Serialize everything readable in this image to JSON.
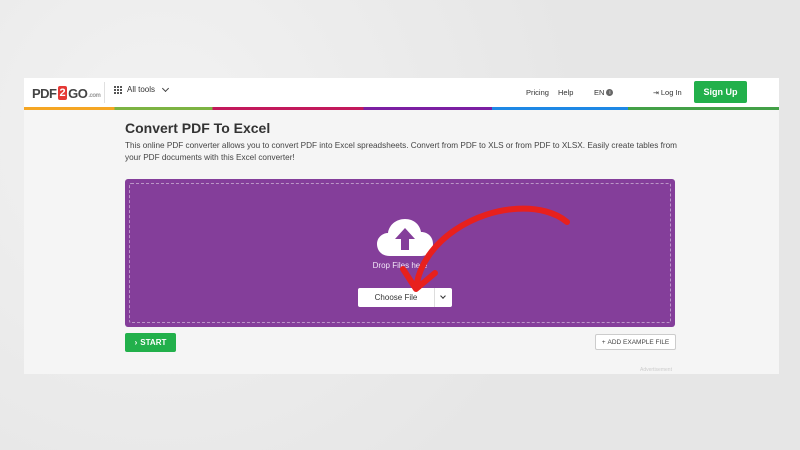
{
  "header": {
    "logo": {
      "pdf": "PDF",
      "two": "2",
      "go": "GO",
      "dotcom": ".com"
    },
    "all_tools": "All tools",
    "pricing": "Pricing",
    "help": "Help",
    "language": "EN",
    "login": "Log In",
    "signup": "Sign Up"
  },
  "main": {
    "title": "Convert PDF To Excel",
    "description": "This online PDF converter allows you to convert PDF into Excel spreadsheets. Convert from PDF to XLS or from PDF to XLSX. Easily create tables from your PDF documents with this Excel converter!",
    "drop_text": "Drop Files here",
    "choose_file": "Choose File",
    "start": "START",
    "add_example": "ADD EXAMPLE FILE",
    "advertisement": "Advertisement"
  },
  "colors": {
    "dropzone": "#843e9a",
    "primary_green": "#22b04b",
    "arrow_red": "#e8201d"
  }
}
